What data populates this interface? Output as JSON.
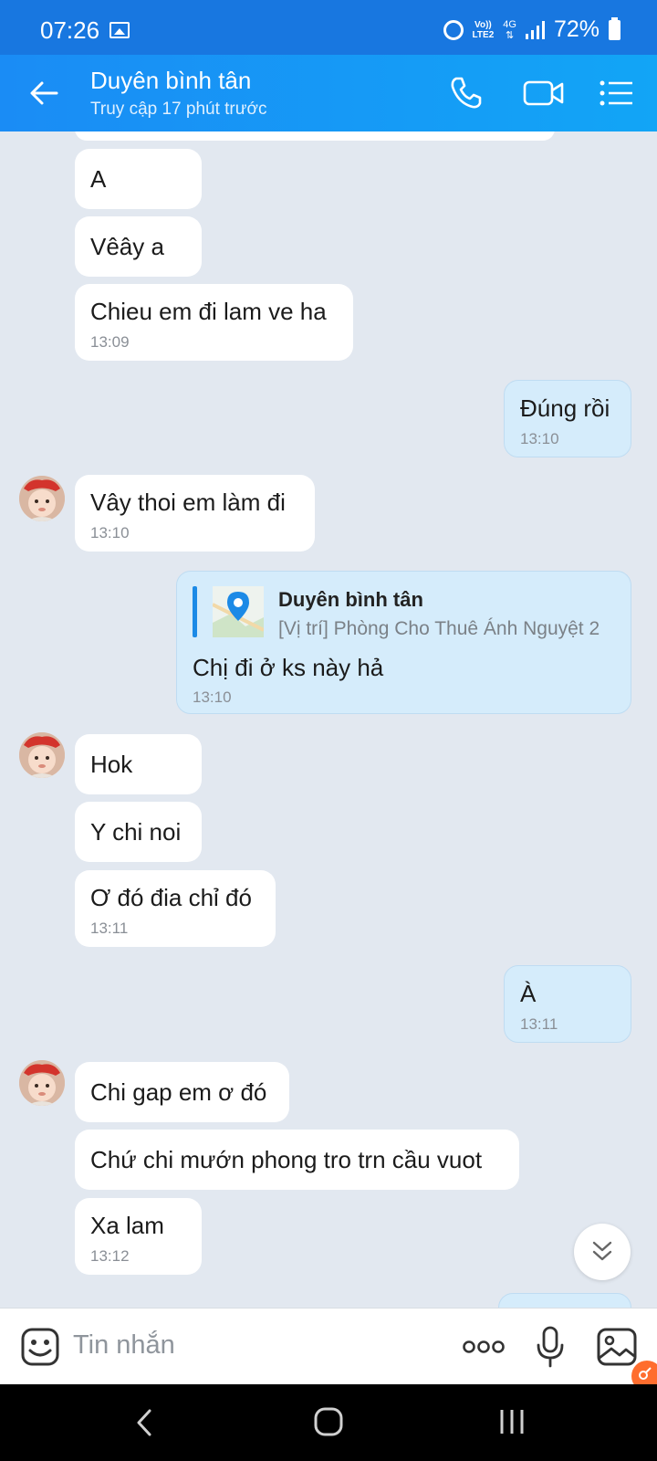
{
  "status_bar": {
    "time": "07:26",
    "network_top": "Vo))",
    "network_bottom": "LTE2",
    "data_type": "4G",
    "battery": "72%"
  },
  "header": {
    "contact_name": "Duyên bình tân",
    "last_seen": "Truy cập 17 phút trước",
    "icons": [
      "back-arrow-icon",
      "phone-icon",
      "video-call-icon",
      "menu-list-icon"
    ]
  },
  "messages": [
    {
      "from": "contact",
      "text": "A",
      "time": ""
    },
    {
      "from": "contact",
      "text": "Vêây a",
      "time": ""
    },
    {
      "from": "contact",
      "text": "Chieu em đi lam ve ha",
      "time": "13:09"
    },
    {
      "from": "me",
      "text": "Đúng rồi",
      "time": "13:10"
    },
    {
      "from": "contact",
      "text": "Vây thoi em làm đi",
      "time": "13:10"
    },
    {
      "from": "me",
      "quote_title": "Duyên bình tân",
      "quote_text": "[Vị trí] Phòng Cho Thuê Ánh Nguyệt 2",
      "text": "Chị đi ở ks này hả",
      "time": "13:10"
    },
    {
      "from": "contact",
      "text": "Hok",
      "time": ""
    },
    {
      "from": "contact",
      "text": "Y chi noi",
      "time": ""
    },
    {
      "from": "contact",
      "text": "Ơ đó đia chỉ đó",
      "time": "13:11"
    },
    {
      "from": "me",
      "text": "À",
      "time": "13:11"
    },
    {
      "from": "contact",
      "text": "Chi gap em ơ đó",
      "time": ""
    },
    {
      "from": "contact",
      "text": "Chứ chi mướn phong tro trn cầu vuot",
      "time": ""
    },
    {
      "from": "contact",
      "text": "Xa lam",
      "time": "13:12"
    }
  ],
  "input": {
    "placeholder": "Tin nhắn"
  },
  "colors": {
    "header": "#1a8cf5",
    "status_bar": "#1877e0",
    "chat_background": "#e2e8f0",
    "my_bubble": "#d5ecfb",
    "contact_bubble": "#ffffff",
    "badge": "#ff6d2e"
  }
}
